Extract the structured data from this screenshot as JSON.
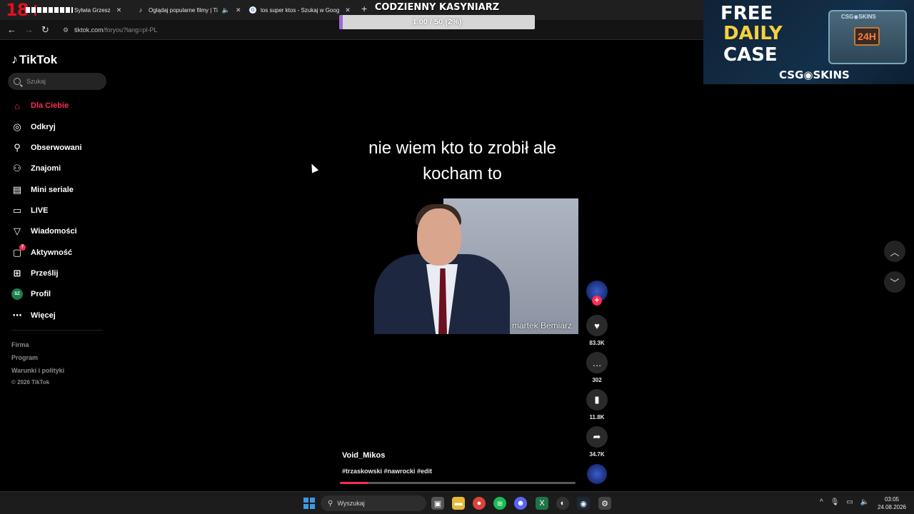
{
  "browser": {
    "age_badge": "18+",
    "tabs": [
      {
        "title": "Sylwia Grzesz",
        "icon": "tiktok-icon"
      },
      {
        "title": "Oglądaj popularne filmy | Ti",
        "icon": "tiktok-icon"
      },
      {
        "title": "los super ktos - Szukaj w Goog",
        "icon": "google-icon"
      }
    ],
    "url_host": "tiktok.com",
    "url_path": "/foryou?lang=pl-PL"
  },
  "overlay_goal": {
    "title": "CODZIENNY KASYNIARZ",
    "progress_text": "1.00 / 50 (2%)",
    "progress_fraction": 0.02
  },
  "ad": {
    "line1": "FREE",
    "line2": "DAILY",
    "line3": "CASE",
    "brand": "CSG◉SKINS",
    "crate_label": "CSG◉SKINS",
    "crate_badge": "24H"
  },
  "sidebar": {
    "logo": "TikTok",
    "search_placeholder": "Szukaj",
    "items": [
      {
        "label": "Dla Ciebie",
        "icon": "home-icon"
      },
      {
        "label": "Odkryj",
        "icon": "compass-icon"
      },
      {
        "label": "Obserwowani",
        "icon": "following-icon"
      },
      {
        "label": "Znajomi",
        "icon": "friends-icon"
      },
      {
        "label": "Mini seriale",
        "icon": "series-icon"
      },
      {
        "label": "LIVE",
        "icon": "live-icon"
      },
      {
        "label": "Wiadomości",
        "icon": "messages-icon"
      },
      {
        "label": "Aktywność",
        "icon": "activity-icon",
        "badge": "7"
      },
      {
        "label": "Prześlij",
        "icon": "upload-icon"
      },
      {
        "label": "Profil",
        "icon": "avatar",
        "avatar_text": "SZ"
      },
      {
        "label": "Więcej",
        "icon": "more-icon"
      }
    ],
    "footer": [
      "Firma",
      "Program",
      "Warunki i polityki",
      "© 2026 TikTok"
    ]
  },
  "video": {
    "caption": "nie wiem kto to zrobił ale kocham to",
    "watermark": "martek Bemiarz",
    "author": "Void_Mikos",
    "hashtags": "#trzaskowski #nawrocki #edit",
    "progress_fraction": 0.12,
    "likes": "83.3K",
    "comments": "302",
    "saves": "11.8K",
    "shares": "34.7K"
  },
  "taskbar": {
    "search_placeholder": "Wyszukaj",
    "time": "03:05",
    "date": "24.08.2026"
  }
}
